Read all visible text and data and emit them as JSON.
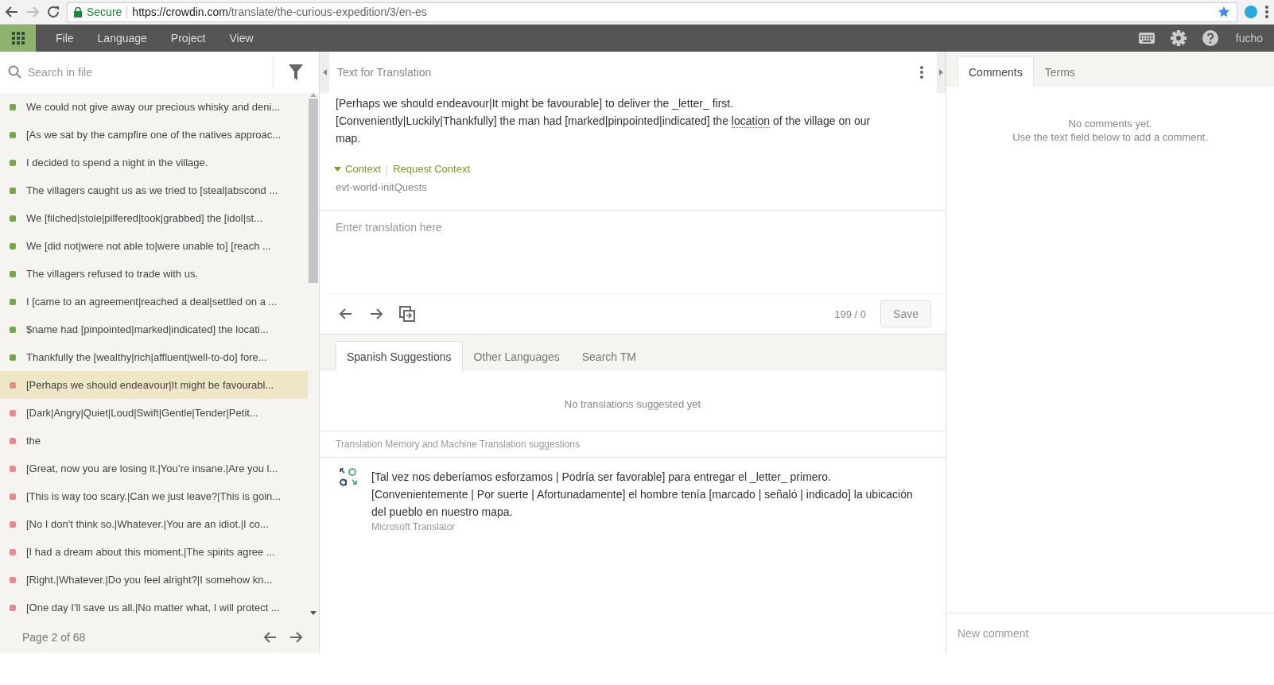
{
  "browser": {
    "security": "Secure",
    "url_host": "https://crowdin.com",
    "url_path": "/translate/the-curious-expedition/3/en-es"
  },
  "menu": [
    "File",
    "Language",
    "Project",
    "View"
  ],
  "user": "fucho",
  "search": {
    "placeholder": "Search in file"
  },
  "strings": [
    {
      "text": "We could not give away our precious whisky and deni...",
      "color": "#75a84a",
      "selected": false
    },
    {
      "text": "[As we sat by the campfire one of the natives approac...",
      "color": "#75a84a",
      "selected": false
    },
    {
      "text": "I decided to spend a night in the village.",
      "color": "#75a84a",
      "selected": false
    },
    {
      "text": "The villagers caught us as we tried to [steal|abscond ...",
      "color": "#75a84a",
      "selected": false
    },
    {
      "text": "We [filched|stole|pilfered|took|grabbed] the [idol|st...",
      "color": "#75a84a",
      "selected": false
    },
    {
      "text": "We [did not|were not able to|were unable to] [reach ...",
      "color": "#75a84a",
      "selected": false
    },
    {
      "text": "The villagers refused to trade with us.",
      "color": "#75a84a",
      "selected": false
    },
    {
      "text": "I [came to an agreement|reached a deal|settled on a ...",
      "color": "#75a84a",
      "selected": false
    },
    {
      "text": "$name had [pinpointed|marked|indicated] the locati...",
      "color": "#75a84a",
      "selected": false
    },
    {
      "text": "Thankfully the [wealthy|rich|affluent|well-to-do] fore...",
      "color": "#75a84a",
      "selected": false
    },
    {
      "text": "[Perhaps we should endeavour|It might be favourabl...",
      "color": "#e88a8a",
      "selected": true
    },
    {
      "text": "[Dark|Angry|Quiet|Loud|Swift|Gentle|Tender|Petit...",
      "color": "#e88a8a",
      "selected": false
    },
    {
      "text": "the",
      "color": "#e88a8a",
      "selected": false
    },
    {
      "text": "[Great, now you are losing it.|You’re insane.|Are you l...",
      "color": "#e88a8a",
      "selected": false
    },
    {
      "text": "[This is way too scary.|Can we just leave?|This is goin...",
      "color": "#e88a8a",
      "selected": false
    },
    {
      "text": "[No I don't think so.|Whatever.|You are an idiot.|I co...",
      "color": "#e88a8a",
      "selected": false
    },
    {
      "text": "[I had a dream about this moment.|The spirits agree ...",
      "color": "#e88a8a",
      "selected": false
    },
    {
      "text": "[Right.|Whatever.|Do you feel alright?|I somehow kn...",
      "color": "#e88a8a",
      "selected": false
    },
    {
      "text": "[One day I'll save us all.|No matter what, I will protect ...",
      "color": "#e88a8a",
      "selected": false
    }
  ],
  "pager": {
    "label": "Page 2 of 68"
  },
  "editor": {
    "title": "Text for Translation",
    "source_segments": [
      {
        "text": "[Perhaps we should endeavour|It might be favourable] to deliver the _letter_ first.\n[Conveniently|Luckily|Thankfully] the man had [marked|pinpointed|indicated] the ",
        "term": false
      },
      {
        "text": "location",
        "term": true
      },
      {
        "text": " of the village on our map.",
        "term": false
      }
    ],
    "context_toggle": "Context",
    "expanded": true,
    "context_separator": "|",
    "request_context": "Request Context",
    "context_key": "evt-world-initQuests",
    "translation": {
      "placeholder": "Enter translation here"
    },
    "counter": "199 / 0",
    "save": "Save"
  },
  "suggestion_tabs": [
    {
      "label": "Spanish Suggestions",
      "selected": true
    },
    {
      "label": "Other Languages",
      "selected": false
    },
    {
      "label": "Search TM",
      "selected": false
    }
  ],
  "suggestions_empty": "No translations suggested yet",
  "tm_heading": "Translation Memory and Machine Translation suggestions",
  "tm_results": [
    {
      "text": "[Tal vez nos deberíamos esforzamos | Podría ser favorable] para entregar el _letter_ primero. [Convenientemente | Por suerte | Afortunadamente] el hombre tenía [marcado | señaló | indicado] la ubicación del pueblo en nuestro mapa.",
      "source": "Microsoft Translator"
    }
  ],
  "comments": {
    "tabs": [
      {
        "label": "Comments",
        "selected": true
      },
      {
        "label": "Terms",
        "selected": false
      }
    ],
    "empty_lines": [
      "No comments yet.",
      "Use the text field below to add a comment."
    ],
    "new_comment": {
      "placeholder": "New comment"
    }
  }
}
